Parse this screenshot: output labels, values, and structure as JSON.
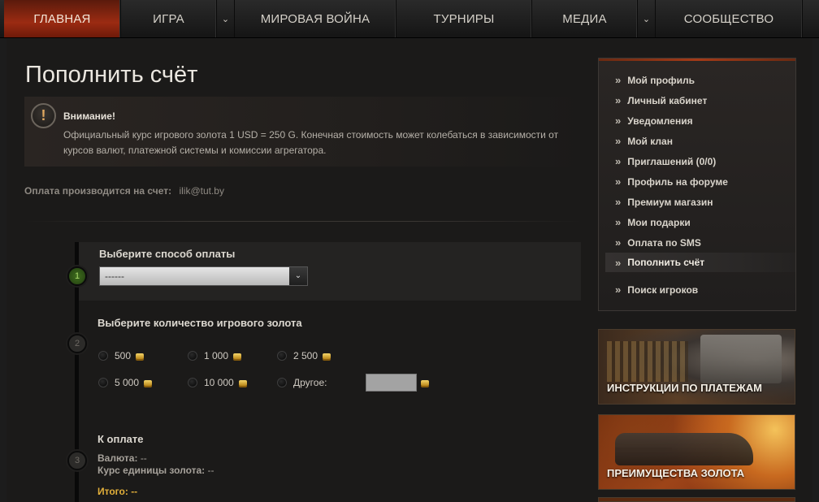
{
  "nav": {
    "items": [
      {
        "label": "ГЛАВНАЯ"
      },
      {
        "label": "ИГРА"
      },
      {
        "label": "МИРОВАЯ ВОЙНА"
      },
      {
        "label": "ТУРНИРЫ"
      },
      {
        "label": "МЕДИА"
      },
      {
        "label": "СООБЩЕСТВО"
      }
    ]
  },
  "page": {
    "title": "Пополнить счёт"
  },
  "warning": {
    "icon_glyph": "!",
    "title": "Внимание!",
    "text": "Официальный курс игрового золота 1 USD = 250 G. Конечная стоимость может колебаться в зависимости от курсов валют, платежной системы и комиссии агрегатора."
  },
  "account": {
    "label": "Оплата производится на счет:",
    "value": "ilik@tut.by"
  },
  "steps": {
    "step1": {
      "number": "1",
      "title": "Выберите способ оплаты",
      "select_value": "------"
    },
    "step2": {
      "number": "2",
      "title": "Выберите количество игрового золота",
      "options": [
        "500",
        "1 000",
        "2 500",
        "5 000",
        "10 000",
        "Другое:"
      ]
    },
    "step3": {
      "number": "3",
      "title": "К оплате",
      "currency_label": "Валюта:",
      "currency_value": "--",
      "rate_label": "Курс единицы золота:",
      "rate_value": "--",
      "total_label": "Итого:",
      "total_value": "--"
    }
  },
  "sidebar": {
    "items": [
      "Мой профиль",
      "Личный кабинет",
      "Уведомления",
      "Мой клан",
      "Приглашений (0/0)",
      "Профиль на форуме",
      "Премиум магазин",
      "Мои подарки",
      "Оплата по SMS",
      "Пополнить счёт",
      "Поиск игроков"
    ],
    "active_index": 9
  },
  "banners": {
    "payment_instructions": "ИНСТРУКЦИИ ПО ПЛАТЕЖАМ",
    "gold_benefits": "ПРЕИМУЩЕСТВА ЗОЛОТА"
  },
  "colors": {
    "accent_red": "#9b2b12",
    "gold": "#e3b03a",
    "step_active": "#3f6d1e"
  }
}
